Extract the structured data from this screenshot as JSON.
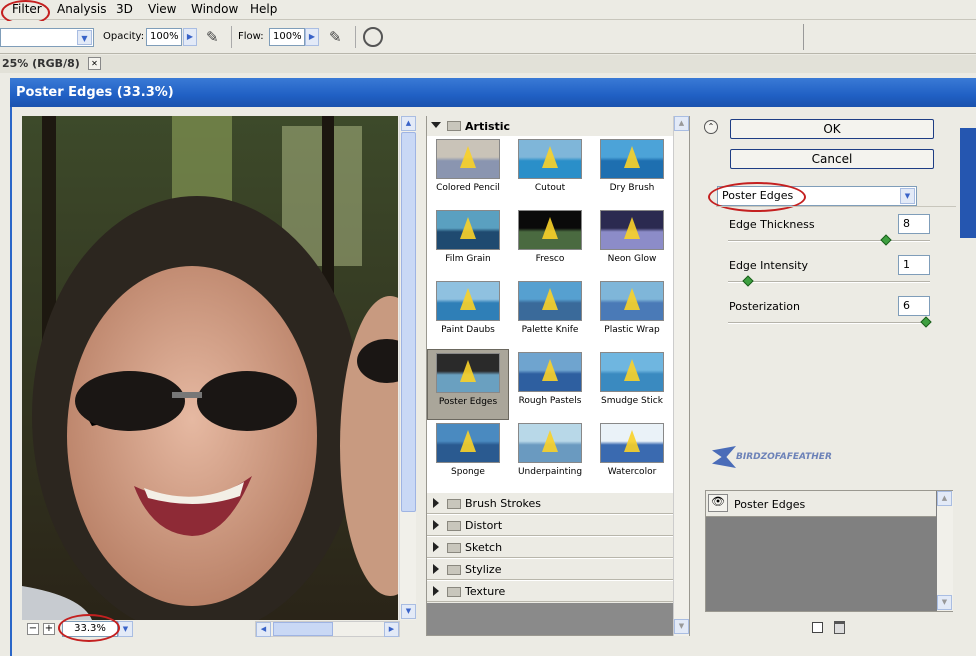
{
  "menu": [
    "Filter",
    "Analysis",
    "3D",
    "View",
    "Window",
    "Help"
  ],
  "options": {
    "opacity_label": "Opacity:",
    "opacity_value": "100%",
    "flow_label": "Flow:",
    "flow_value": "100%"
  },
  "doc_tab": {
    "label": "25% (RGB/8)",
    "close": "✕"
  },
  "dialog": {
    "title": "Poster Edges (33.3%)"
  },
  "zoom": {
    "minus": "−",
    "plus": "+",
    "value": "33.3%"
  },
  "gallery": {
    "open_category": "Artistic",
    "filters": [
      "Colored Pencil",
      "Cutout",
      "Dry Brush",
      "Film Grain",
      "Fresco",
      "Neon Glow",
      "Paint Daubs",
      "Palette Knife",
      "Plastic Wrap",
      "Poster Edges",
      "Rough Pastels",
      "Smudge Stick",
      "Sponge",
      "Underpainting",
      "Watercolor"
    ],
    "selected": "Poster Edges",
    "categories": [
      "Brush Strokes",
      "Distort",
      "Sketch",
      "Stylize",
      "Texture"
    ]
  },
  "buttons": {
    "ok": "OK",
    "cancel": "Cancel"
  },
  "settings": {
    "filter": "Poster Edges",
    "params": [
      {
        "label": "Edge Thickness",
        "value": "8",
        "level": 0.8
      },
      {
        "label": "Edge Intensity",
        "value": "1",
        "level": 0.1
      },
      {
        "label": "Posterization",
        "value": "6",
        "level": 1.0
      }
    ]
  },
  "watermark": "BIRDZOFAFEATHER",
  "effect_layer": "Poster Edges"
}
